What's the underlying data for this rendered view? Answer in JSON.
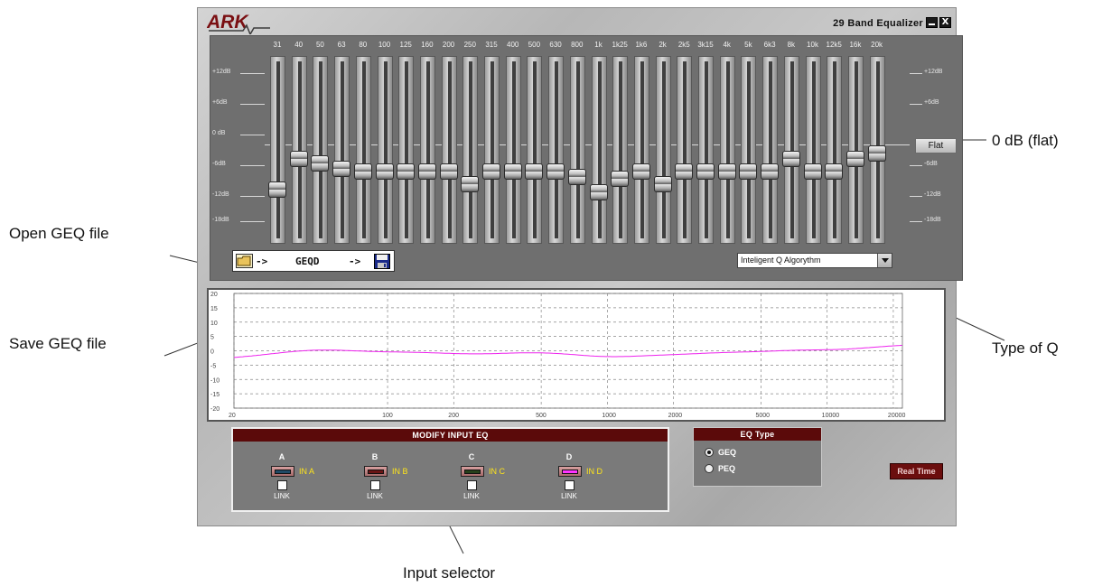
{
  "window": {
    "logo_text": "ARK",
    "title": "29 Band Equalizer",
    "minimize_icon": "minimize-icon",
    "close_label": "X"
  },
  "eq": {
    "bands": [
      "31",
      "40",
      "50",
      "63",
      "80",
      "100",
      "125",
      "160",
      "200",
      "250",
      "315",
      "400",
      "500",
      "630",
      "800",
      "1k",
      "1k25",
      "1k6",
      "2k",
      "2k5",
      "3k15",
      "4k",
      "5k",
      "6k3",
      "8k",
      "10k",
      "12k5",
      "16k",
      "20k"
    ],
    "gains_db": [
      -4,
      2,
      1,
      0,
      -0.5,
      -0.5,
      -0.5,
      -0.5,
      -0.5,
      -3,
      -0.5,
      -0.5,
      -0.5,
      -0.5,
      -1.5,
      -4.5,
      -2,
      -0.5,
      -3,
      -0.5,
      -0.5,
      -0.5,
      -0.5,
      -0.5,
      2,
      -0.5,
      -0.5,
      2,
      3
    ],
    "db_labels_left": [
      "+12dB",
      "+6dB",
      "0 dB",
      "-6dB",
      "-12dB",
      "-18dB"
    ],
    "db_labels_right": [
      "+12dB",
      "+6dB",
      "-6dB",
      "-12dB",
      "-18dB"
    ],
    "db_levels": [
      12,
      6,
      0,
      -6,
      -12,
      -18
    ],
    "flat_label": "Flat",
    "file_arrow_1": "->",
    "file_name": "GEQD",
    "file_arrow_2": "->",
    "q_type": "Inteligent Q Algorythm"
  },
  "graph": {
    "y_ticks": [
      "20",
      "15",
      "10",
      "5",
      "0",
      "-5",
      "-10",
      "-15",
      "-20"
    ],
    "x_ticks": [
      "20",
      "100",
      "200",
      "500",
      "1000",
      "2000",
      "5000",
      "10000",
      "20000"
    ],
    "curve_color": "#ee22ee"
  },
  "modify_input": {
    "title": "MODIFY INPUT EQ",
    "inputs": [
      {
        "letter": "A",
        "label": "IN A",
        "color": "#1f4a66",
        "link": "LINK"
      },
      {
        "letter": "B",
        "label": "IN B",
        "color": "#6a1414",
        "link": "LINK"
      },
      {
        "letter": "C",
        "label": "IN C",
        "color": "#25401a",
        "link": "LINK"
      },
      {
        "letter": "D",
        "label": "IN D",
        "color": "#ff33ff",
        "link": "LINK"
      }
    ]
  },
  "eq_type": {
    "title": "EQ Type",
    "options": [
      "GEQ",
      "PEQ"
    ],
    "selected": "GEQ"
  },
  "realtime_label": "Real Time",
  "callouts": {
    "open_file": "Open GEQ file",
    "save_file": "Save GEQ file",
    "flat": "0 dB (flat)",
    "q_type": "Type of Q",
    "input_selector": "Input selector"
  }
}
